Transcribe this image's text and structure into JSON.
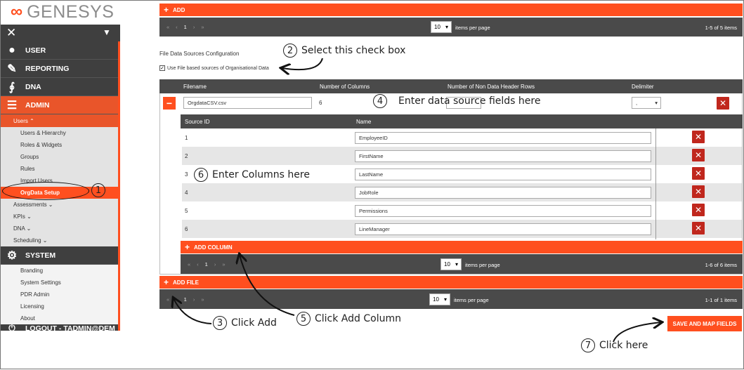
{
  "logo": {
    "mark": "∞",
    "word": "GENESYS"
  },
  "sidebar": {
    "nav": [
      {
        "label": "USER"
      },
      {
        "label": "REPORTING"
      },
      {
        "label": "DNA"
      },
      {
        "label": "ADMIN"
      }
    ],
    "admin_sub": {
      "head": "Users ⌃",
      "items": [
        "Users & Hierarchy",
        "Roles & Widgets",
        "Groups",
        "Rules",
        "Import Users",
        "OrgData Setup"
      ]
    },
    "groups": [
      "Assessments ⌄",
      "KPIs ⌄",
      "DNA ⌄",
      "Scheduling ⌄"
    ],
    "system": {
      "label": "SYSTEM",
      "items": [
        "Branding",
        "System Settings",
        "PDR Admin",
        "Licensing",
        "About"
      ]
    },
    "logout": "LOGOUT - TADMIN@DEM"
  },
  "top": {
    "add_label": "ADD",
    "pager": {
      "first": "«",
      "prev": "‹",
      "page": "1",
      "next": "›",
      "last": "»",
      "size": "10",
      "ipp": "items per page",
      "count": "1-5 of 5 items"
    }
  },
  "config": {
    "title": "File Data Sources Configuration",
    "checkbox_label": "Use File based sources of Organisational Data",
    "checked": true
  },
  "files_table": {
    "headers": [
      "Filename",
      "Number of Columns",
      "Number of Non Data Header Rows",
      "Delimiter"
    ],
    "row": {
      "filename": "OrgdataCSV.csv",
      "columns": "6",
      "header_rows": "",
      "delimiter": ","
    }
  },
  "columns_table": {
    "headers": [
      "Source ID",
      "Name"
    ],
    "rows": [
      {
        "id": "1",
        "name": "EmployeeID"
      },
      {
        "id": "2",
        "name": "FirstName"
      },
      {
        "id": "3",
        "name": "LastName"
      },
      {
        "id": "4",
        "name": "JobRole"
      },
      {
        "id": "5",
        "name": "Permissions"
      },
      {
        "id": "6",
        "name": "LineManager"
      }
    ],
    "add_column": "ADD COLUMN",
    "pager": {
      "size": "10",
      "ipp": "items per page",
      "count": "1-6 of 6 items"
    }
  },
  "bottom": {
    "add_file": "ADD FILE",
    "pager": {
      "size": "10",
      "ipp": "items per page",
      "count": "1-1 of 1 items"
    },
    "save": "SAVE AND MAP FIELDS"
  },
  "callouts": [
    {
      "num": "1",
      "text": ""
    },
    {
      "num": "2",
      "text": "Select this check box"
    },
    {
      "num": "3",
      "text": "Click Add"
    },
    {
      "num": "4",
      "text": "Enter data source fields here"
    },
    {
      "num": "5",
      "text": "Click Add Column"
    },
    {
      "num": "6",
      "text": "Enter Columns here"
    },
    {
      "num": "7",
      "text": "Click here"
    }
  ],
  "colors": {
    "accent": "#ff4f1f",
    "sidebar": "#3f3f3f",
    "delete": "#c0271d"
  }
}
